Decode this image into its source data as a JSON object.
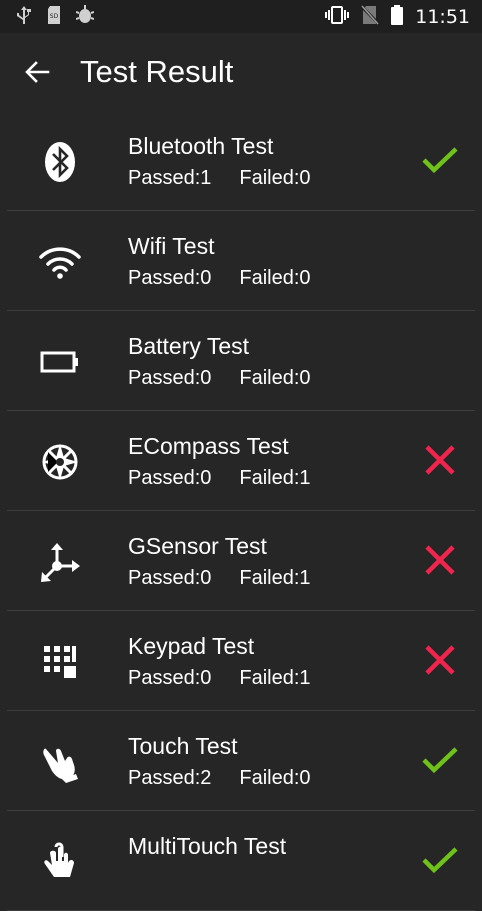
{
  "status_bar": {
    "time": "11:51",
    "left_icons": [
      "usb-icon",
      "sd-card-icon",
      "android-debug-icon"
    ],
    "right_icons": [
      "vibrate-icon",
      "no-sim-icon",
      "battery-icon"
    ]
  },
  "app_bar": {
    "title": "Test Result",
    "back_icon": "arrow-back-icon"
  },
  "colors": {
    "background": "#262626",
    "pass": "#6ec21a",
    "fail": "#f0254e",
    "divider": "#3d3d3d"
  },
  "tests": [
    {
      "name": "Bluetooth Test",
      "passed": "Passed:1",
      "failed": "Failed:0",
      "icon": "bluetooth-icon",
      "result": "pass"
    },
    {
      "name": "Wifi Test",
      "passed": "Passed:0",
      "failed": "Failed:0",
      "icon": "wifi-icon",
      "result": "none"
    },
    {
      "name": "Battery Test",
      "passed": "Passed:0",
      "failed": "Failed:0",
      "icon": "battery-icon",
      "result": "none"
    },
    {
      "name": "ECompass Test",
      "passed": "Passed:0",
      "failed": "Failed:1",
      "icon": "compass-icon",
      "result": "fail"
    },
    {
      "name": "GSensor Test",
      "passed": "Passed:0",
      "failed": "Failed:1",
      "icon": "axes-icon",
      "result": "fail"
    },
    {
      "name": "Keypad Test",
      "passed": "Passed:0",
      "failed": "Failed:1",
      "icon": "keypad-icon",
      "result": "fail"
    },
    {
      "name": "Touch Test",
      "passed": "Passed:2",
      "failed": "Failed:0",
      "icon": "touch-icon",
      "result": "pass"
    },
    {
      "name": "MultiTouch Test",
      "passed": "",
      "failed": "",
      "icon": "multitouch-icon",
      "result": "pass"
    }
  ]
}
